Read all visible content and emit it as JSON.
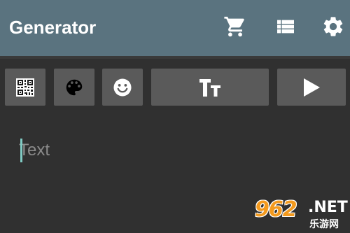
{
  "appbar": {
    "title": "Generator",
    "actions": [
      {
        "name": "cart",
        "icon": "cart-icon"
      },
      {
        "name": "list",
        "icon": "list-icon"
      },
      {
        "name": "settings",
        "icon": "gear-icon"
      }
    ]
  },
  "toolbar": {
    "buttons": [
      {
        "name": "qr-code",
        "icon": "qr-code-icon"
      },
      {
        "name": "palette",
        "icon": "palette-icon"
      },
      {
        "name": "emoji",
        "icon": "smiley-icon"
      },
      {
        "name": "text-size",
        "icon": "text-size-icon"
      },
      {
        "name": "play",
        "icon": "play-icon"
      }
    ]
  },
  "editor": {
    "value": "",
    "placeholder": "Text"
  },
  "watermark": {
    "number": "962",
    "net": ".NET",
    "chinese": "乐游网"
  },
  "colors": {
    "appbar": "#5a737f",
    "background": "#303030",
    "button": "#5a5a5a",
    "cursor": "#80cbc4",
    "watermark_orange": "#f39a1e"
  }
}
